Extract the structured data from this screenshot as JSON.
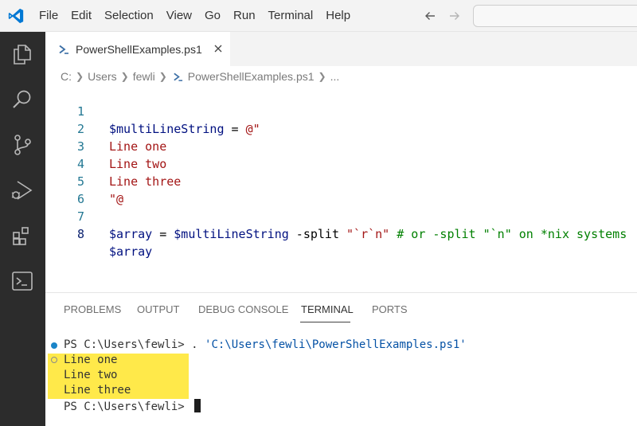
{
  "menu": [
    "File",
    "Edit",
    "Selection",
    "View",
    "Go",
    "Run",
    "Terminal",
    "Help"
  ],
  "tab": {
    "label": "PowerShellExamples.ps1",
    "close_glyph": "×"
  },
  "breadcrumb": {
    "drive": "C:",
    "users": "Users",
    "user": "fewli",
    "file": "PowerShellExamples.ps1",
    "more": "..."
  },
  "editor": {
    "lines": [
      {
        "number": "1",
        "parts": [
          "$multiLineString",
          " = ",
          "@\""
        ]
      },
      {
        "number": "2",
        "text": "Line one"
      },
      {
        "number": "3",
        "text": "Line two"
      },
      {
        "number": "4",
        "text": "Line three"
      },
      {
        "number": "5",
        "text": "\"@"
      },
      {
        "number": "6",
        "text": ""
      },
      {
        "number": "7",
        "parts": [
          "$array",
          " = ",
          "$multiLineString",
          " -split ",
          "\"`r`n\"",
          " # or -split \"`n\" on *nix systems"
        ]
      },
      {
        "number": "8",
        "text": "$array"
      }
    ]
  },
  "panel": {
    "tabs": [
      "PROBLEMS",
      "OUTPUT",
      "DEBUG CONSOLE",
      "TERMINAL",
      "PORTS"
    ],
    "active_tab": "TERMINAL"
  },
  "terminal": {
    "command_prompt": "PS C:\\Users\\fewli> . ",
    "command_path": "'C:\\Users\\fewli\\PowerShellExamples.ps1'",
    "output": [
      "Line one",
      "Line two",
      "Line three"
    ],
    "final_prompt": "PS C:\\Users\\fewli> "
  },
  "colors": {
    "activity_bar": "#2c2c2c",
    "highlight": "#ffe94a",
    "string": "#a31515",
    "variable": "#001080",
    "comment": "#008000",
    "line_number": "#237893"
  }
}
